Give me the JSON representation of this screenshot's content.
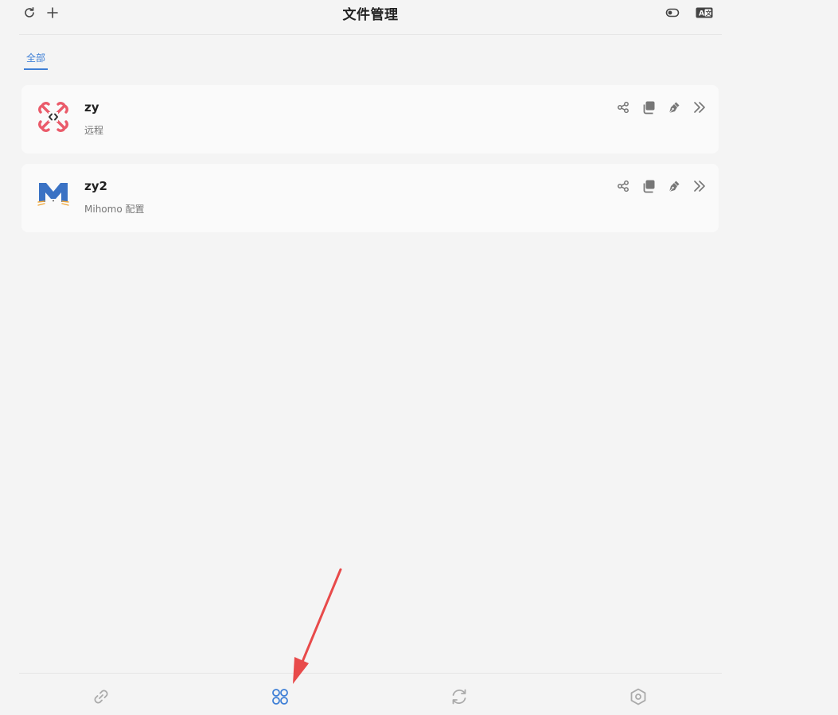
{
  "header": {
    "title": "文件管理",
    "refresh_icon": "refresh-icon",
    "add_icon": "plus-icon",
    "toggle_icon": "toggle-icon",
    "translate_icon": "translate-icon"
  },
  "tabs": [
    {
      "label": "全部",
      "active": true
    }
  ],
  "profiles": [
    {
      "name": "zy",
      "description": "远程",
      "logo": "remote-logo-icon"
    },
    {
      "name": "zy2",
      "description": "Mihomo 配置",
      "logo": "mihomo-logo-icon"
    }
  ],
  "card_actions": [
    "share-icon",
    "copy-icon",
    "edit-icon",
    "more-icon"
  ],
  "bottom_nav": [
    {
      "name": "link-icon",
      "active": false
    },
    {
      "name": "apps-grid-icon",
      "active": true
    },
    {
      "name": "sync-icon",
      "active": false
    },
    {
      "name": "settings-hexagon-icon",
      "active": false
    }
  ],
  "colors": {
    "accent": "#3e7fd6",
    "icon_gray": "#888888",
    "annotation_arrow": "#e84a4a",
    "remote_logo": "#ea5b6a",
    "mihomo_logo": "#3a72c4"
  }
}
